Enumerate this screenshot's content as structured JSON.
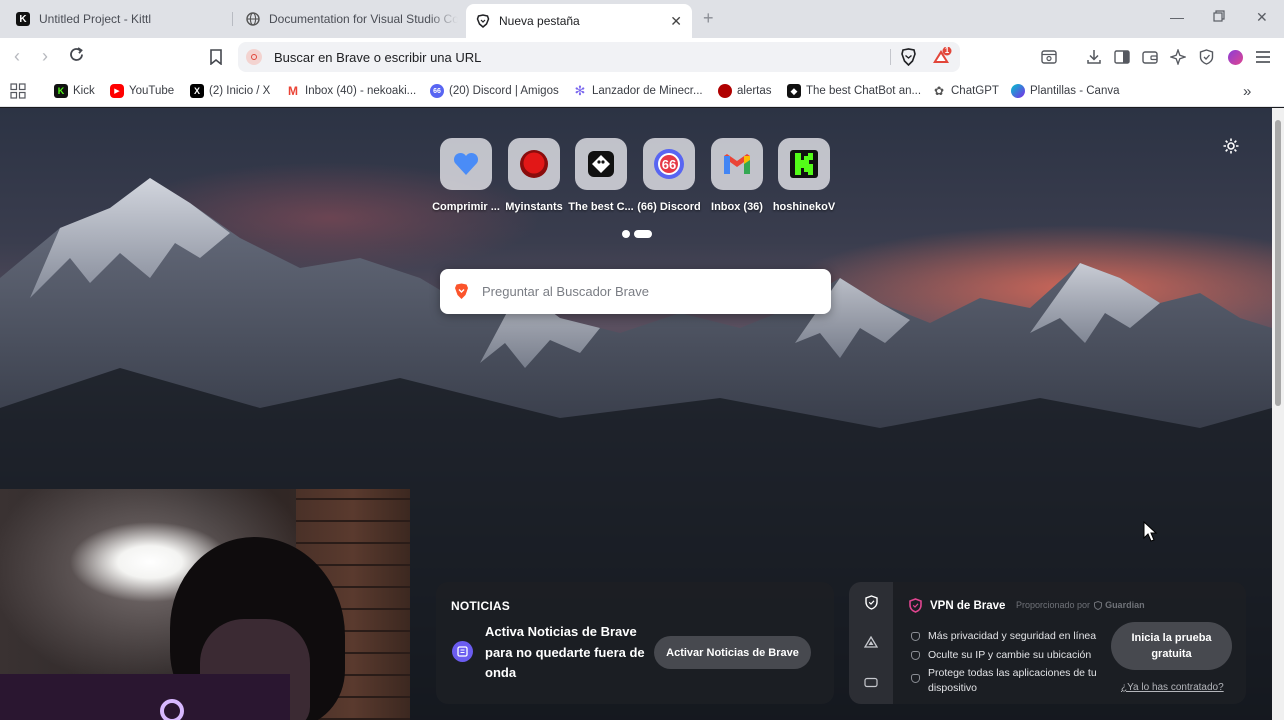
{
  "tabs": [
    {
      "title": "Untitled Project - Kittl",
      "icon": "kittl-icon"
    },
    {
      "title": "Documentation for Visual Studio Code",
      "icon": "globe-icon"
    },
    {
      "title": "Nueva pestaña",
      "icon": "brave-lion-icon",
      "active": true
    }
  ],
  "toolbar": {
    "url_placeholder": "Buscar en Brave o escribir una URL",
    "rewards_badge": "1"
  },
  "bookmarks": [
    {
      "label": "Kick",
      "color": "#53fc18"
    },
    {
      "label": "YouTube",
      "color": "#ff0000"
    },
    {
      "label": "(2) Inicio / X",
      "color": "#000000"
    },
    {
      "label": "Inbox (40) - nekoaki...",
      "color": "#ea4335"
    },
    {
      "label": "(20) Discord | Amigos",
      "color": "#5865f2"
    },
    {
      "label": "Lanzador de Minecr...",
      "color": "#7b68ee"
    },
    {
      "label": "alertas",
      "color": "#b00000"
    },
    {
      "label": "The best ChatBot an...",
      "color": "#111111"
    },
    {
      "label": "ChatGPT",
      "color": "#555555"
    },
    {
      "label": "Plantillas - Canva",
      "color": "#00c4cc"
    }
  ],
  "top_sites": [
    {
      "label": "Comprimir ...",
      "icon": "heart-icon"
    },
    {
      "label": "Myinstants",
      "icon": "red-button-icon"
    },
    {
      "label": "The best C...",
      "icon": "chatbot-icon"
    },
    {
      "label": "(66) Discord",
      "icon": "discord-icon",
      "badge": "66"
    },
    {
      "label": "Inbox (36)",
      "icon": "gmail-icon"
    },
    {
      "label": "hoshinekoV",
      "icon": "kick-icon"
    }
  ],
  "search": {
    "placeholder": "Preguntar al Buscador Brave"
  },
  "news": {
    "heading": "NOTICIAS",
    "description": "Activa Noticias de Brave para no quedarte fuera de onda",
    "button": "Activar Noticias de Brave"
  },
  "vpn": {
    "title": "VPN de Brave",
    "provided_by": "Proporcionado por",
    "provider": "Guardian",
    "features": [
      "Más privacidad y seguridad en línea",
      "Oculte su IP y cambie su ubicación",
      "Protege todas las aplicaciones de tu dispositivo"
    ],
    "trial_button": "Inicia la prueba gratuita",
    "already_link": "¿Ya lo has contratado?"
  },
  "colors": {
    "brave_orange": "#fb542b",
    "news_accent": "#6b5cf0"
  }
}
